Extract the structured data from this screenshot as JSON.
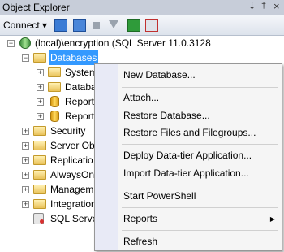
{
  "window": {
    "title": "Object Explorer",
    "pin_glyph": "⇣",
    "pushpin_glyph": "†",
    "close_glyph": "×"
  },
  "toolbar": {
    "connect_label": "Connect ▾",
    "icons": [
      "connect-object-explorer-icon",
      "disconnect-icon",
      "stop-icon",
      "filter-icon",
      "refresh-icon",
      "activity-monitor-icon"
    ]
  },
  "tree": {
    "server": "(local)\\encryption (SQL Server 11.0.3128",
    "databases": "Databases",
    "system_db": "System",
    "db_snap": "Databa",
    "report1": "Report",
    "report2": "Report",
    "security": "Security",
    "server_objects": "Server Obj",
    "replication": "Replicatio",
    "alwayson": "AlwaysOn",
    "management": "Managem",
    "integration": "Integration",
    "agent": "SQL Server",
    "expand_glyph": "+",
    "collapse_glyph": "−"
  },
  "context_menu": {
    "new_database": "New Database...",
    "attach": "Attach...",
    "restore_database": "Restore Database...",
    "restore_files": "Restore Files and Filegroups...",
    "deploy_dac": "Deploy Data-tier Application...",
    "import_dac": "Import Data-tier Application...",
    "start_powershell": "Start PowerShell",
    "reports": "Reports",
    "refresh": "Refresh",
    "submenu_arrow": "▶"
  },
  "colors": {
    "selection": "#3399ff",
    "folder": "#f2d36b",
    "menu_bg": "#f5f5f5"
  }
}
